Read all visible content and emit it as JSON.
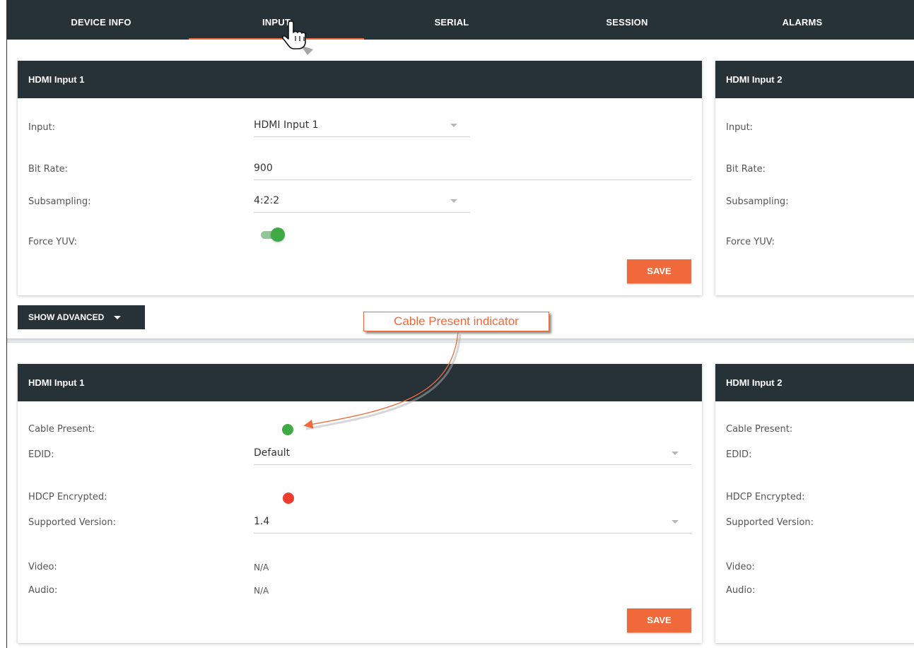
{
  "tabs": [
    {
      "label": "DEVICE INFO"
    },
    {
      "label": "INPUT"
    },
    {
      "label": "SERIAL"
    },
    {
      "label": "SESSION"
    },
    {
      "label": "ALARMS"
    }
  ],
  "input_panel": {
    "card1": {
      "title": "HDMI Input 1",
      "input_label": "Input:",
      "input_value": "HDMI Input 1",
      "bitrate_label": "Bit Rate:",
      "bitrate_value": "900",
      "subsampling_label": "Subsampling:",
      "subsampling_value": "4:2:2",
      "forceyuv_label": "Force YUV:",
      "forceyuv_on": true,
      "save_label": "SAVE"
    },
    "card2": {
      "title": "HDMI Input 2",
      "input_label": "Input:",
      "bitrate_label": "Bit Rate:",
      "subsampling_label": "Subsampling:",
      "forceyuv_label": "Force YUV:"
    }
  },
  "advanced_button": {
    "label": "SHOW ADVANCED"
  },
  "callout": {
    "text": "Cable Present indicator"
  },
  "advanced_panel": {
    "card1": {
      "title": "HDMI Input 1",
      "cable_label": "Cable Present:",
      "cable_color": "#3faa45",
      "edid_label": "EDID:",
      "edid_value": "Default",
      "hdcp_label": "HDCP Encrypted:",
      "hdcp_color": "#f03c2e",
      "version_label": "Supported Version:",
      "version_value": "1.4",
      "video_label": "Video:",
      "video_value": "N/A",
      "audio_label": "Audio:",
      "audio_value": "N/A",
      "save_label": "SAVE"
    },
    "card2": {
      "title": "HDMI Input 2",
      "cable_label": "Cable Present:",
      "edid_label": "EDID:",
      "hdcp_label": "HDCP Encrypted:",
      "version_label": "Supported Version:",
      "video_label": "Video:",
      "audio_label": "Audio:"
    }
  },
  "colors": {
    "accent": "#f0693a",
    "header": "#263238",
    "status_on": "#3faa45",
    "status_off": "#f03c2e"
  },
  "icons": [
    "hand-pointer-icon",
    "chevron-down-icon"
  ]
}
